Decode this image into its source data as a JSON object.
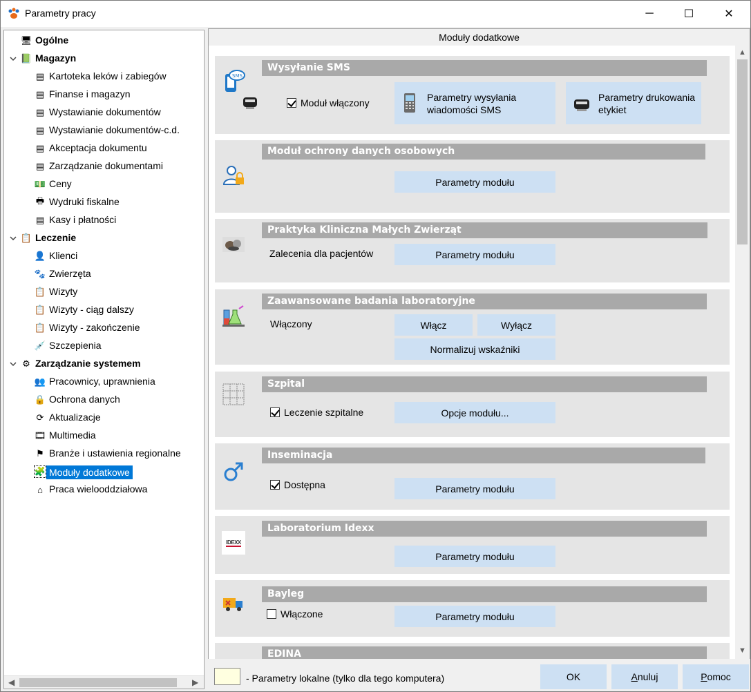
{
  "window": {
    "title": "Parametry pracy",
    "minimize_glyph": "─",
    "maximize_glyph": "☐",
    "close_glyph": "✕"
  },
  "tree": {
    "items": [
      {
        "label": "Ogólne",
        "bold": true,
        "level": 0,
        "icon": "computer-icon",
        "glyph": "🖥"
      },
      {
        "label": "Magazyn",
        "bold": true,
        "level": 0,
        "expanded": true,
        "icon": "warehouse-icon",
        "glyph": "📗"
      },
      {
        "label": "Kartoteka leków i zabiegów",
        "level": 1,
        "icon": "drug-card-icon",
        "glyph": "▤"
      },
      {
        "label": "Finanse i magazyn",
        "level": 1,
        "icon": "finance-icon",
        "glyph": "▤"
      },
      {
        "label": "Wystawianie dokumentów",
        "level": 1,
        "icon": "document-add-icon",
        "glyph": "▤"
      },
      {
        "label": "Wystawianie dokumentów-c.d.",
        "level": 1,
        "icon": "document-add-icon",
        "glyph": "▤"
      },
      {
        "label": "Akceptacja dokumentu",
        "level": 1,
        "icon": "document-accept-icon",
        "glyph": "▤"
      },
      {
        "label": "Zarządzanie dokumentami",
        "level": 1,
        "icon": "documents-icon",
        "glyph": "▤"
      },
      {
        "label": "Ceny",
        "level": 1,
        "icon": "money-icon",
        "glyph": "💵"
      },
      {
        "label": "Wydruki fiskalne",
        "level": 1,
        "icon": "printer-icon",
        "glyph": "🖶"
      },
      {
        "label": "Kasy i płatności",
        "level": 1,
        "icon": "cash-icon",
        "glyph": "▤"
      },
      {
        "label": "Leczenie",
        "bold": true,
        "level": 0,
        "expanded": true,
        "icon": "clipboard-icon",
        "glyph": "📋"
      },
      {
        "label": "Klienci",
        "level": 1,
        "icon": "person-icon",
        "glyph": "👤"
      },
      {
        "label": "Zwierzęta",
        "level": 1,
        "icon": "paw-icon",
        "glyph": "🐾"
      },
      {
        "label": "Wizyty",
        "level": 1,
        "icon": "clipboard-check-icon",
        "glyph": "📋"
      },
      {
        "label": "Wizyty - ciąg dalszy",
        "level": 1,
        "icon": "clipboard-check-icon",
        "glyph": "📋"
      },
      {
        "label": "Wizyty - zakończenie",
        "level": 1,
        "icon": "clipboard-check-icon",
        "glyph": "📋"
      },
      {
        "label": "Szczepienia",
        "level": 1,
        "icon": "syringe-icon",
        "glyph": "💉"
      },
      {
        "label": "Zarządzanie systemem",
        "bold": true,
        "level": 0,
        "expanded": true,
        "icon": "system-icon",
        "glyph": "⚙"
      },
      {
        "label": "Pracownicy, uprawnienia",
        "level": 1,
        "icon": "users-icon",
        "glyph": "👥"
      },
      {
        "label": "Ochrona danych",
        "level": 1,
        "icon": "lock-icon",
        "glyph": "🔒"
      },
      {
        "label": "Aktualizacje",
        "level": 1,
        "icon": "update-icon",
        "glyph": "⟳"
      },
      {
        "label": "Multimedia",
        "level": 1,
        "icon": "multimedia-icon",
        "glyph": "🎞"
      },
      {
        "label": "Branże i ustawienia regionalne",
        "level": 1,
        "icon": "flag-icon",
        "glyph": "⚑"
      },
      {
        "label": "Moduły dodatkowe",
        "level": 1,
        "selected": true,
        "icon": "module-icon",
        "glyph": "🧩"
      },
      {
        "label": "Praca wielooddziałowa",
        "level": 1,
        "icon": "home-icon",
        "glyph": "⌂"
      }
    ]
  },
  "right": {
    "header": "Moduły dodatkowe",
    "modules": {
      "sms": {
        "title": "Wysyłanie SMS",
        "checkbox_label": "Moduł włączony",
        "checked": true,
        "btn1": "Parametry wysyłania wiadomości SMS",
        "btn2": "Parametry drukowania etykiet"
      },
      "rodo": {
        "title": "Moduł ochrony danych osobowych",
        "btn": "Parametry modułu"
      },
      "pkmz": {
        "title": "Praktyka Kliniczna Małych Zwierząt",
        "label": "Zalecenia dla pacjentów",
        "btn": "Parametry modułu"
      },
      "lab": {
        "title": "Zaawansowane badania laboratoryjne",
        "label": "Włączony",
        "btn_on": "Włącz",
        "btn_off": "Wyłącz",
        "btn_norm": "Normalizuj wskaźniki"
      },
      "hospital": {
        "title": "Szpital",
        "checkbox_label": "Leczenie szpitalne",
        "checked": true,
        "btn": "Opcje modułu..."
      },
      "insemination": {
        "title": "Inseminacja",
        "checkbox_label": "Dostępna",
        "checked": true,
        "btn": "Parametry modułu"
      },
      "idexx": {
        "title": "Laboratorium Idexx",
        "logo_text": "IDEXX",
        "btn": "Parametry modułu"
      },
      "bayleg": {
        "title": "Bayleg",
        "checkbox_label": "Włączone",
        "checked": false,
        "btn": "Parametry modułu"
      },
      "edina": {
        "title": "EDINA"
      }
    }
  },
  "footer": {
    "legend_text": "- Parametry lokalne (tylko dla tego komputera)",
    "ok": "OK",
    "cancel": "Anuluj",
    "help": "Pomoc"
  },
  "colors": {
    "selection": "#0078d7",
    "module_header": "#a9a9a9",
    "module_bg": "#e5e5e5",
    "button_bg": "#cde0f3",
    "legend_local": "#ffffe0"
  }
}
